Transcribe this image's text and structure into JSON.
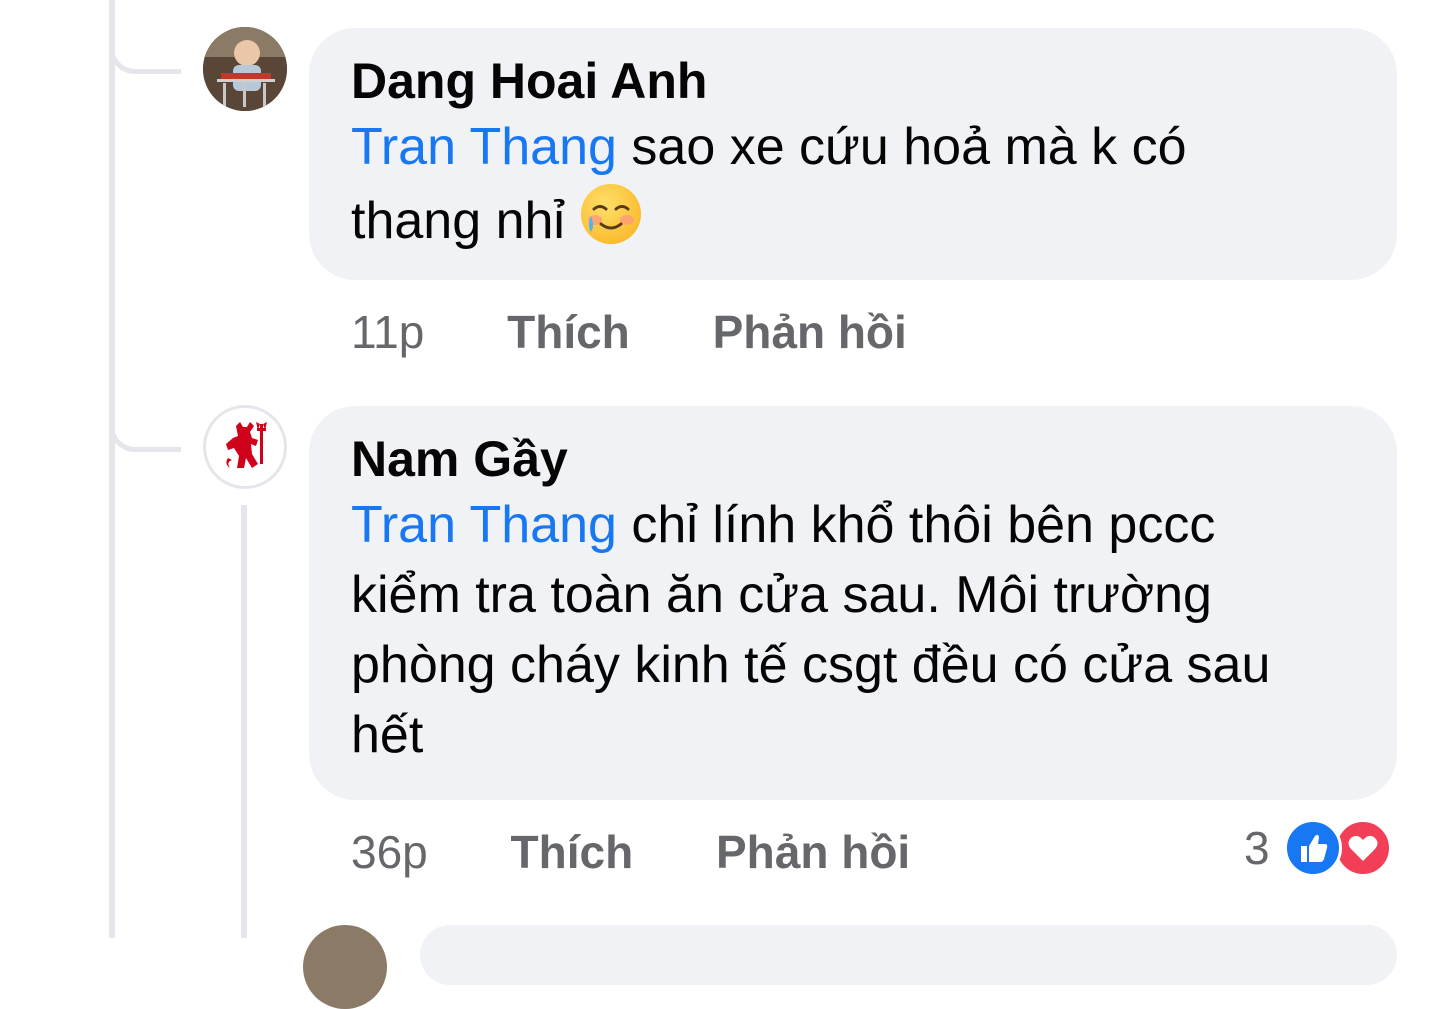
{
  "comments": [
    {
      "author": "Dang Hoai Anh",
      "mention": "Tran Thang",
      "text_line1": "sao xe cứu hoả mà k có",
      "text_line2": "thang nhỉ",
      "emoji": "smiling-face-with-tear",
      "time": "11p",
      "like_label": "Thích",
      "reply_label": "Phản hồi"
    },
    {
      "author": "Nam Gầy",
      "mention": "Tran Thang",
      "text_line1": "chỉ lính khổ thôi bên pccc",
      "text_line2": "kiểm tra toàn ăn cửa sau. Môi trường",
      "text_line3": "phòng cháy kinh tế csgt đều có cửa sau",
      "text_line4": "hết",
      "time": "36p",
      "like_label": "Thích",
      "reply_label": "Phản hồi",
      "reaction_count": "3",
      "reactions": [
        "like-icon",
        "love-icon"
      ]
    }
  ],
  "colors": {
    "mention": "#1877f2",
    "bubble": "#f0f2f5",
    "meta_text": "#65676b",
    "like": "#1877f2",
    "love": "#f33e58"
  }
}
